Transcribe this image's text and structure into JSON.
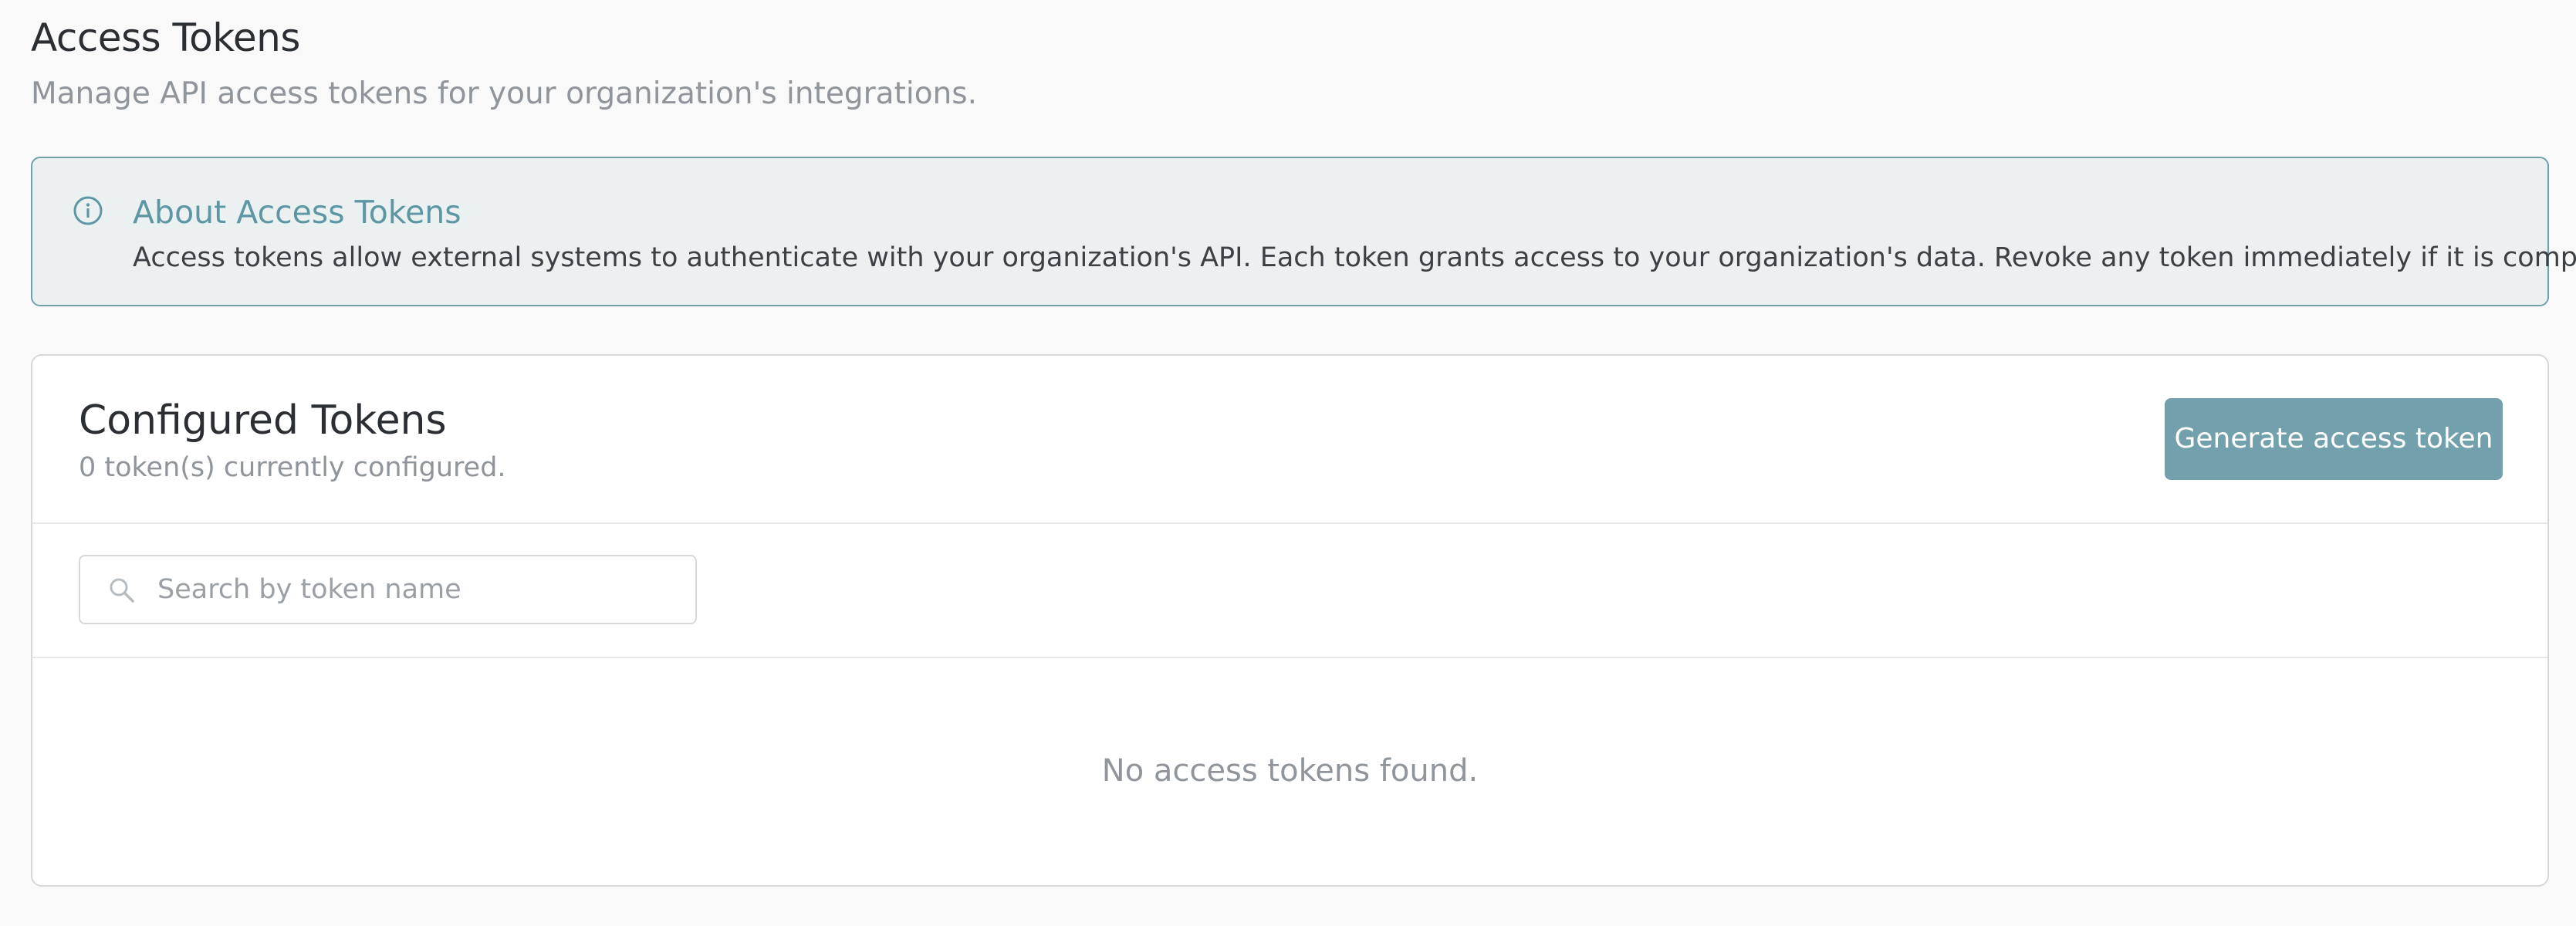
{
  "page": {
    "title": "Access Tokens",
    "subtitle": "Manage API access tokens for your organization's integrations."
  },
  "info": {
    "icon": "info-circle-icon",
    "title": "About Access Tokens",
    "text": "Access tokens allow external systems to authenticate with your organization's API. Each token grants access to your organization's data. Revoke any token immediately if it is compromised."
  },
  "tokens": {
    "title": "Configured Tokens",
    "count_text": "0 token(s) currently configured.",
    "generate_label": "Generate access token",
    "search": {
      "icon": "search-icon",
      "placeholder": "Search by token name",
      "value": ""
    },
    "empty_text": "No access tokens found.",
    "items": []
  },
  "colors": {
    "accent": "#72a0ac",
    "info_bg": "#ebf1f1",
    "info_border": "#72a0a9",
    "info_title": "#5e97a3",
    "muted_text": "#8f959a",
    "page_bg": "#f9f9f9"
  }
}
